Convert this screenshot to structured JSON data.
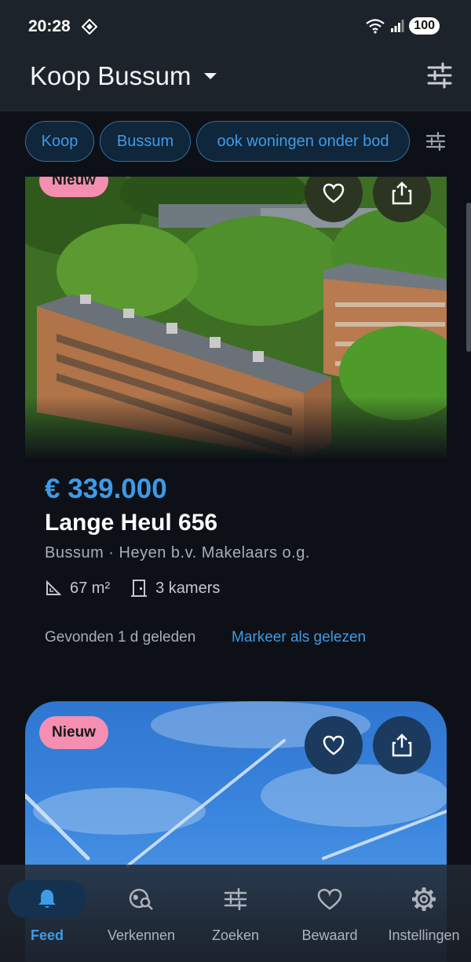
{
  "status": {
    "time": "20:28",
    "battery": "100"
  },
  "header": {
    "title": "Koop Bussum"
  },
  "chips": [
    "Koop",
    "Bussum",
    "ook woningen onder bod"
  ],
  "listings": [
    {
      "badge": "Nieuw",
      "price": "€ 339.000",
      "address": "Lange Heul 656",
      "meta": "Bussum · Heyen b.v. Makelaars o.g.",
      "area": "67 m²",
      "rooms": "3 kamers",
      "found": "Gevonden 1 d geleden",
      "mark_read": "Markeer als gelezen"
    },
    {
      "badge": "Nieuw"
    }
  ],
  "nav": [
    {
      "label": "Feed",
      "icon": "bell-icon"
    },
    {
      "label": "Verkennen",
      "icon": "explore-icon"
    },
    {
      "label": "Zoeken",
      "icon": "sliders-icon"
    },
    {
      "label": "Bewaard",
      "icon": "heart-icon"
    },
    {
      "label": "Instellingen",
      "icon": "gear-icon"
    }
  ],
  "colors": {
    "accent": "#3d9be8",
    "badge": "#f48fb1",
    "background": "#0d1117",
    "appbar": "#1d232b"
  }
}
